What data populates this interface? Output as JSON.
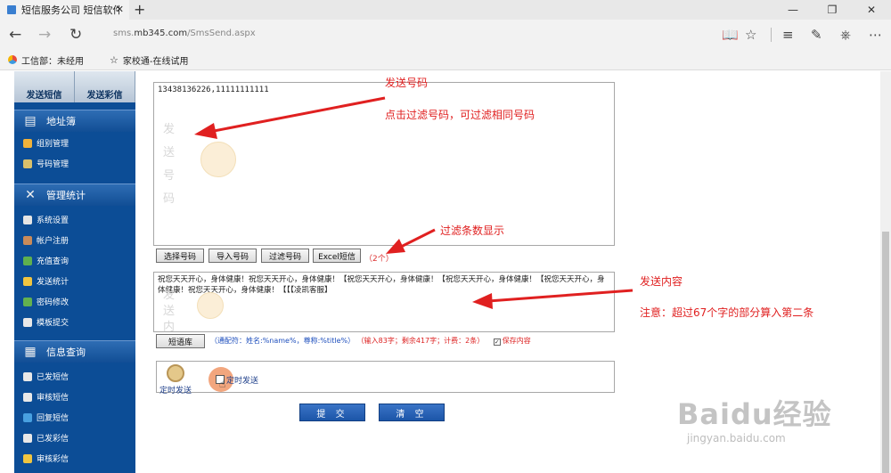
{
  "browser": {
    "tab_title": "短信服务公司 短信软件",
    "tab_close": "✕",
    "new_tab": "+",
    "window_min": "—",
    "window_max": "❐",
    "window_close": "✕",
    "url_prefix": "sms.",
    "url_domain": "mb345.com",
    "url_path": "/SmsSend.aspx",
    "favorites": [
      "工信部：未经用",
      "家校通-在线试用"
    ]
  },
  "sidebar": {
    "top_buttons": [
      "发送短信",
      "发送彩信"
    ],
    "sections": [
      {
        "title": "地址簿",
        "icon": "address-book-icon",
        "items": [
          "组别管理",
          "号码管理"
        ]
      },
      {
        "title": "管理统计",
        "icon": "tools-icon",
        "items": [
          "系统设置",
          "帐户注册",
          "充值查询",
          "发送统计",
          "密码修改",
          "模板提交"
        ]
      },
      {
        "title": "信息查询",
        "icon": "book-icon",
        "items": [
          "已发短信",
          "审核短信",
          "回复短信",
          "已发彩信",
          "审核彩信"
        ]
      }
    ]
  },
  "numbers": {
    "value": "13438136226,11111111111",
    "watermark": "发送号码"
  },
  "buttons": {
    "select": "选择号码",
    "import": "导入号码",
    "filter": "过滤号码",
    "excel": "Excel短信",
    "count": "（2个）"
  },
  "content": {
    "value": "祝您天天开心，身体健康！祝您天天开心，身体健康！【祝您天天开心，身体健康！【祝您天天开心，身体健康！【祝您天天开心，身体健康！祝您天天开心，身体健康！【【【凌凯客服】",
    "watermark": "发送内容",
    "library_button": "短语库",
    "wildcard_info": "（通配符：姓名:%name%，尊称:%title%）",
    "count_info": "（输入83字；剩余417字；计费：2条）",
    "save_check": "✓",
    "save_label": "保存内容"
  },
  "timer": {
    "label": "定时发送",
    "check_label": "定时发送"
  },
  "actions": {
    "submit": "提 交",
    "clear": "清 空"
  },
  "annotations": {
    "send_numbers": "发送号码",
    "filter_hint": "点击过滤号码，可过滤相同号码",
    "count_display": "过滤条数显示",
    "send_content": "发送内容",
    "note": "注意：超过67个字的部分算入第二条"
  },
  "watermark": {
    "logo": "Baidu经验",
    "url": "jingyan.baidu.com"
  },
  "colors": {
    "sidebar": "#0c4d96",
    "annotation": "#e02020",
    "button": "#1c55a8"
  }
}
